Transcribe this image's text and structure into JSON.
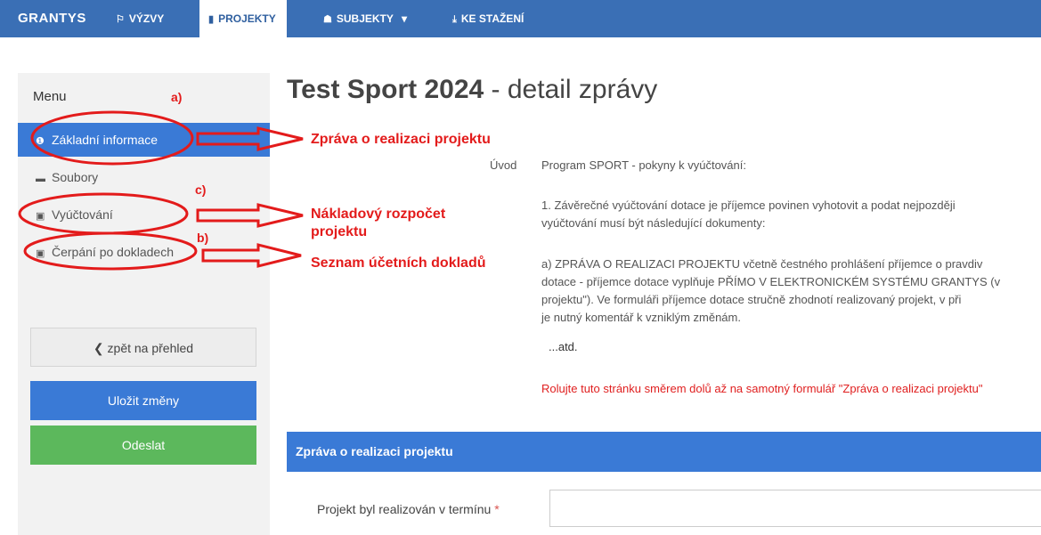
{
  "topbar": {
    "brand": "GRANTYS",
    "nav": [
      {
        "label": "VÝZVY",
        "icon": "megaphone-icon",
        "glyph": "⚐"
      },
      {
        "label": "PROJEKTY",
        "icon": "file-icon",
        "glyph": "▮"
      },
      {
        "label": "SUBJEKTY",
        "icon": "users-icon",
        "glyph": "☗",
        "caret": "▾"
      },
      {
        "label": "KE STAŽENÍ",
        "icon": "download-icon",
        "glyph": "⤓"
      }
    ]
  },
  "sidebar": {
    "menu_title": "Menu",
    "items": [
      {
        "label": "Základní informace",
        "icon": "info-icon",
        "glyph": "❶"
      },
      {
        "label": "Soubory",
        "icon": "folder-icon",
        "glyph": "▬"
      },
      {
        "label": "Vyúčtování",
        "icon": "money-icon",
        "glyph": "▣"
      },
      {
        "label": "Čerpání po dokladech",
        "icon": "money-icon",
        "glyph": "▣"
      }
    ],
    "back_label": "❮ zpět na přehled",
    "save_label": "Uložit změny",
    "send_label": "Odeslat"
  },
  "main": {
    "title_bold": "Test Sport 2024",
    "title_light": " - detail zprávy",
    "uvod_label": "Úvod",
    "paragraphs": [
      "Program SPORT - pokyny k vyúčtování:",
      "1.   Závěrečné vyúčtování dotace je příjemce povinen vyhotovit a podat nejpozději",
      "vyúčtování musí být následující dokumenty:",
      "a)   ZPRÁVA O REALIZACI PROJEKTU včetně čestného prohlášení příjemce o pravdiv",
      "dotace - příjemce dotace vyplňuje PŘÍMO V ELEKTRONICKÉM SYSTÉMU GRANTYS (v",
      "projektu\"). Ve formuláři příjemce dotace stručně zhodnotí realizovaný projekt, v při",
      "je nutný komentář k vzniklým změnám.",
      "...atd.",
      "Rolujte tuto stránku směrem dolů až na samotný formulář \"Zpráva o realizaci projektu\""
    ],
    "panel_title": "Zpráva o realizaci projektu",
    "form_label": "Projekt byl realizován v termínu",
    "required_mark": "*"
  },
  "annotations": {
    "a": "a)",
    "b": "b)",
    "c": "c)",
    "label_a": "Zpráva o realizaci projektu",
    "label_c_1": "Nákladový rozpočet",
    "label_c_2": "projektu",
    "label_b": "Seznam účetních dokladů",
    "color": "#e31b1b"
  }
}
